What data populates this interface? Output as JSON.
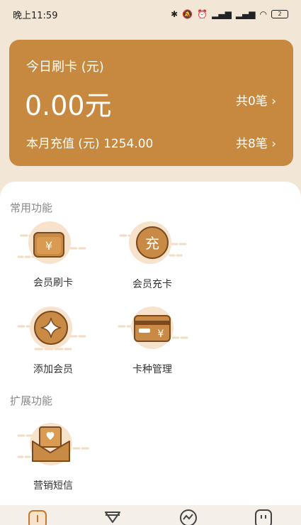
{
  "status_bar": {
    "time": "晚上11:59",
    "battery": "2"
  },
  "summary": {
    "today_title": "今日刷卡 (元)",
    "today_amount": "0.00元",
    "today_count": "共0笔 ›",
    "month_label": "本月充值 (元) 1254.00",
    "month_count": "共8笔 ›"
  },
  "sections": {
    "common_title": "常用功能",
    "extended_title": "扩展功能"
  },
  "functions": {
    "swipe": {
      "label": "会员刷卡",
      "icon": "yen-wallet-icon",
      "glyph": "¥"
    },
    "recharge": {
      "label": "会员充卡",
      "icon": "recharge-icon",
      "glyph": "充"
    },
    "add_member": {
      "label": "添加会员",
      "icon": "sparkle-icon"
    },
    "card_type": {
      "label": "卡种管理",
      "icon": "card-icon",
      "glyph": "¥"
    },
    "sms": {
      "label": "营销短信",
      "icon": "envelope-heart-icon"
    }
  },
  "nav": {
    "items": [
      {
        "icon": "home-icon"
      },
      {
        "icon": "diamond-icon"
      },
      {
        "icon": "chart-icon"
      },
      {
        "icon": "profile-icon"
      }
    ]
  },
  "colors": {
    "card": "#c6893f",
    "page_bg": "#f2e6d6",
    "icon_primary": "#c07a35",
    "icon_light": "#f7e3cc"
  }
}
